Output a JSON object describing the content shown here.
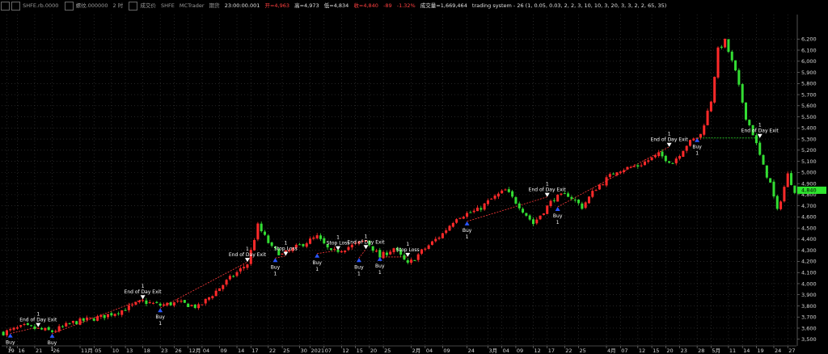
{
  "header": {
    "symbol": "SHFE.rb.0000",
    "name": "螺纹.000000",
    "interval": "2 时",
    "price_type": "成交价",
    "exchange": "SHFE",
    "source": "MCTrader",
    "period": "期货",
    "datetime": "23:00:00.001",
    "open_label": "开=4,963",
    "high_label": "高=4,973",
    "low_label": "低=4,834",
    "close_label": "收=4,840",
    "change": "-89",
    "change_pct": "-1.32%",
    "volume_label": "成交量=1,669,464",
    "strategy": "trading system - 26 (1, 0.05, 0.03, 2, 2, 3, 10, 10, 3, 20, 3, 3, 2, 2, 65, 35)"
  },
  "colors": {
    "up": "#ff2a2a",
    "down": "#33dd33",
    "last_price": "#2ee62e",
    "entry": "#2a56ff",
    "trade_line": "#ff3a3a",
    "grid": "#3c3c3c",
    "axis": "#888888"
  },
  "chart_data": {
    "type": "candlestick",
    "title": "",
    "xlabel": "",
    "ylabel": "",
    "ylim": [
      3440,
      6420
    ],
    "y_ticks": [
      3500,
      3600,
      3700,
      3800,
      3900,
      4000,
      4100,
      4200,
      4300,
      4400,
      4500,
      4600,
      4700,
      4800,
      4900,
      5000,
      5100,
      5200,
      5300,
      5400,
      5500,
      5600,
      5700,
      5800,
      5900,
      6000,
      6100,
      6200
    ],
    "y_tick_labels": [
      "3,500",
      "3,600",
      "3,700",
      "3,800",
      "3,900",
      "4,000",
      "4,100",
      "4,200",
      "4,300",
      "4,400",
      "4,500",
      "4,600",
      "4,700",
      "4,800",
      "4,900",
      "5,000",
      "5,100",
      "5,200",
      "5,300",
      "5,400",
      "5,500",
      "5,600",
      "5,700",
      "5,800",
      "5,900",
      "6,000",
      "6,100",
      "6,200"
    ],
    "last_price_label": "4,840",
    "x_labels": [
      {
        "label": "19",
        "i": 1
      },
      {
        "label": "16",
        "i": 4
      },
      {
        "label": "21",
        "i": 9
      },
      {
        "label": "26",
        "i": 14
      },
      {
        "label": "11月",
        "i": 22
      },
      {
        "label": "05",
        "i": 26
      },
      {
        "label": "10",
        "i": 31
      },
      {
        "label": "13",
        "i": 35
      },
      {
        "label": "18",
        "i": 40
      },
      {
        "label": "23",
        "i": 45
      },
      {
        "label": "26",
        "i": 49
      },
      {
        "label": "12月",
        "i": 53
      },
      {
        "label": "04",
        "i": 57
      },
      {
        "label": "09",
        "i": 62
      },
      {
        "label": "14",
        "i": 67
      },
      {
        "label": "17",
        "i": 71
      },
      {
        "label": "22",
        "i": 76
      },
      {
        "label": "25",
        "i": 80
      },
      {
        "label": "30",
        "i": 85
      },
      {
        "label": "2021",
        "i": 88
      },
      {
        "label": "07",
        "i": 92
      },
      {
        "label": "12",
        "i": 97
      },
      {
        "label": "15",
        "i": 101
      },
      {
        "label": "20",
        "i": 105
      },
      {
        "label": "25",
        "i": 109
      },
      {
        "label": "2月",
        "i": 117
      },
      {
        "label": "04",
        "i": 121
      },
      {
        "label": "09",
        "i": 126
      },
      {
        "label": "24",
        "i": 133
      },
      {
        "label": "3月",
        "i": 139
      },
      {
        "label": "04",
        "i": 143
      },
      {
        "label": "09",
        "i": 147
      },
      {
        "label": "12",
        "i": 152
      },
      {
        "label": "17",
        "i": 156
      },
      {
        "label": "22",
        "i": 161
      },
      {
        "label": "25",
        "i": 165
      },
      {
        "label": "4月",
        "i": 173
      },
      {
        "label": "07",
        "i": 177
      },
      {
        "label": "12",
        "i": 182
      },
      {
        "label": "15",
        "i": 186
      },
      {
        "label": "20",
        "i": 190
      },
      {
        "label": "23",
        "i": 194
      },
      {
        "label": "28",
        "i": 199
      },
      {
        "label": "5月",
        "i": 203
      },
      {
        "label": "11",
        "i": 208
      },
      {
        "label": "14",
        "i": 212
      },
      {
        "label": "19",
        "i": 216
      },
      {
        "label": "24",
        "i": 221
      },
      {
        "label": "27",
        "i": 225
      }
    ],
    "anchors": [
      [
        0,
        3560
      ],
      [
        6,
        3615
      ],
      [
        10,
        3590
      ],
      [
        14,
        3570
      ],
      [
        20,
        3650
      ],
      [
        28,
        3700
      ],
      [
        34,
        3760
      ],
      [
        40,
        3840
      ],
      [
        45,
        3805
      ],
      [
        50,
        3830
      ],
      [
        56,
        3790
      ],
      [
        64,
        4020
      ],
      [
        70,
        4180
      ],
      [
        73,
        4520
      ],
      [
        77,
        4320
      ],
      [
        80,
        4260
      ],
      [
        86,
        4360
      ],
      [
        90,
        4420
      ],
      [
        94,
        4280
      ],
      [
        100,
        4340
      ],
      [
        104,
        4390
      ],
      [
        108,
        4240
      ],
      [
        112,
        4320
      ],
      [
        116,
        4170
      ],
      [
        120,
        4290
      ],
      [
        126,
        4450
      ],
      [
        130,
        4600
      ],
      [
        136,
        4660
      ],
      [
        140,
        4760
      ],
      [
        144,
        4840
      ],
      [
        148,
        4700
      ],
      [
        152,
        4540
      ],
      [
        158,
        4770
      ],
      [
        162,
        4800
      ],
      [
        166,
        4690
      ],
      [
        170,
        4860
      ],
      [
        176,
        5020
      ],
      [
        182,
        5060
      ],
      [
        188,
        5160
      ],
      [
        192,
        5090
      ],
      [
        196,
        5250
      ],
      [
        200,
        5340
      ],
      [
        203,
        5650
      ],
      [
        205,
        6100
      ],
      [
        207,
        6180
      ],
      [
        210,
        5900
      ],
      [
        213,
        5500
      ],
      [
        215,
        5350
      ],
      [
        218,
        5050
      ],
      [
        220,
        4900
      ],
      [
        222,
        4650
      ],
      [
        225,
        4980
      ],
      [
        227,
        4840
      ]
    ],
    "trades": [
      {
        "type": "buy",
        "text": "Buy",
        "qty": "1",
        "i": 2,
        "price": 3552
      },
      {
        "type": "exit",
        "text": "End of Day Exit",
        "qty": "1",
        "i": 10,
        "price": 3610
      },
      {
        "type": "buy",
        "text": "Buy",
        "qty": "1",
        "i": 14,
        "price": 3550
      },
      {
        "type": "exit",
        "text": "End of Day Exit",
        "qty": "1",
        "i": 40,
        "price": 3860
      },
      {
        "type": "buy",
        "text": "Buy",
        "qty": "1",
        "i": 45,
        "price": 3780
      },
      {
        "type": "exit",
        "text": "End of Day Exit",
        "qty": "1",
        "i": 70,
        "price": 4195
      },
      {
        "type": "buy",
        "text": "Buy",
        "qty": "1",
        "i": 78,
        "price": 4230
      },
      {
        "type": "exit",
        "text": "Stop Loss",
        "qty": "1",
        "i": 81,
        "price": 4250
      },
      {
        "type": "buy",
        "text": "Buy",
        "qty": "1",
        "i": 90,
        "price": 4270
      },
      {
        "type": "exit",
        "text": "Stop Loss",
        "qty": "1",
        "i": 96,
        "price": 4300
      },
      {
        "type": "buy",
        "text": "Buy",
        "qty": "1",
        "i": 102,
        "price": 4230
      },
      {
        "type": "exit",
        "text": "End of Day Exit",
        "qty": "1",
        "i": 104,
        "price": 4310
      },
      {
        "type": "buy",
        "text": "Buy",
        "qty": "1",
        "i": 108,
        "price": 4240
      },
      {
        "type": "exit",
        "text": "Stop Loss",
        "qty": "1",
        "i": 116,
        "price": 4240
      },
      {
        "type": "buy",
        "text": "Buy",
        "qty": "1",
        "i": 133,
        "price": 4560
      },
      {
        "type": "exit",
        "text": "End of Day Exit",
        "qty": "1",
        "i": 156,
        "price": 4780
      },
      {
        "type": "buy",
        "text": "Buy",
        "qty": "1",
        "i": 159,
        "price": 4690
      },
      {
        "type": "exit",
        "text": "End of Day Exit",
        "qty": "1",
        "i": 191,
        "price": 5230
      },
      {
        "type": "buy",
        "text": "Buy",
        "qty": "1",
        "i": 199,
        "price": 5310
      },
      {
        "type": "exit",
        "text": "End of Day Exit",
        "qty": "1",
        "i": 217,
        "price": 5310
      }
    ]
  }
}
